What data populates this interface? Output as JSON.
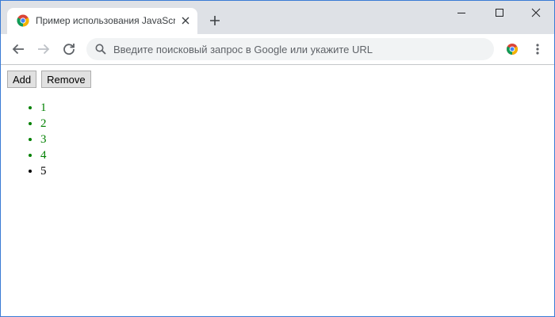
{
  "browser": {
    "tab": {
      "title": "Пример использования JavaScript"
    },
    "omnibox": {
      "placeholder": "Введите поисковый запрос в Google или укажите URL"
    },
    "icons": [
      "chrome-favicon",
      "tab-close-icon",
      "new-tab-icon",
      "minimize-icon",
      "maximize-icon",
      "close-icon",
      "back-icon",
      "forward-icon",
      "reload-icon",
      "search-icon",
      "extension-icon",
      "menu-icon"
    ]
  },
  "page": {
    "buttons": {
      "add": "Add",
      "remove": "Remove"
    },
    "list": [
      {
        "text": "1",
        "highlighted": true
      },
      {
        "text": "2",
        "highlighted": true
      },
      {
        "text": "3",
        "highlighted": true
      },
      {
        "text": "4",
        "highlighted": true
      },
      {
        "text": "5",
        "highlighted": false
      }
    ]
  },
  "colors": {
    "highlight": "#008000",
    "normal": "#000000",
    "tabstrip": "#dee1e6"
  }
}
